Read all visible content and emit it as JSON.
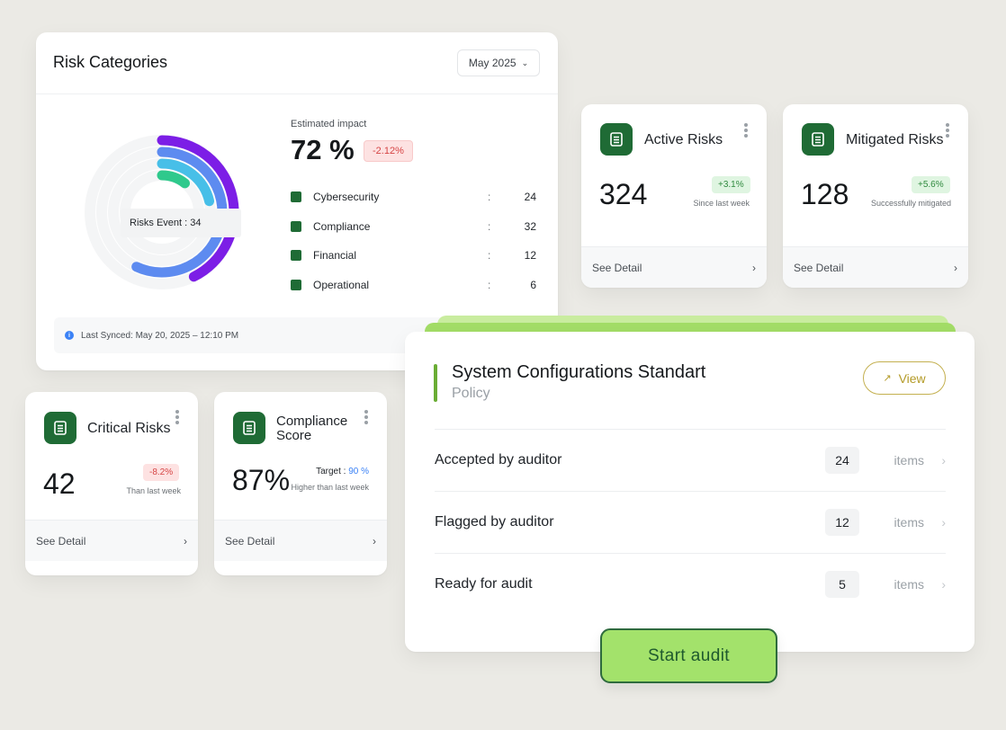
{
  "risk_categories": {
    "title": "Risk Categories",
    "month": "May 2025",
    "tooltip": "Risks Event : 34",
    "impact_label": "Estimated impact",
    "impact_value": "72 %",
    "impact_change": "-2.12%",
    "categories": [
      {
        "name": "Cybersecurity",
        "value": "24",
        "color": "#7c1ee6"
      },
      {
        "name": "Compliance",
        "value": "32",
        "color": "#5d8bf0"
      },
      {
        "name": "Financial",
        "value": "12",
        "color": "#47bfe8"
      },
      {
        "name": "Operational",
        "value": "6",
        "color": "#2fc98c"
      }
    ],
    "sync_text": "Last Synced: May 20, 2025 – 12:10 PM"
  },
  "active_risks": {
    "title": "Active Risks",
    "value": "324",
    "badge": "+3.1%",
    "subtext": "Since last week",
    "detail": "See Detail"
  },
  "mitigated_risks": {
    "title": "Mitigated Risks",
    "value": "128",
    "badge": "+5.6%",
    "subtext": "Successfully mitigated",
    "detail": "See Detail"
  },
  "critical_risks": {
    "title": "Critical Risks",
    "value": "42",
    "badge": "-8.2%",
    "subtext": "Than last week",
    "detail": "See Detail"
  },
  "compliance_score": {
    "title_line1": "Compliance",
    "title_line2": "Score",
    "value": "87%",
    "target_label": "Target :",
    "target_value": "90 %",
    "subtext": "Higher than last week",
    "detail": "See Detail"
  },
  "policy": {
    "title": "System Configurations Standart",
    "subtitle": "Policy",
    "view_label": "View",
    "rows": [
      {
        "label": "Accepted by auditor",
        "count": "24",
        "unit": "items"
      },
      {
        "label": "Flagged by auditor",
        "count": "12",
        "unit": "items"
      },
      {
        "label": "Ready for audit",
        "count": "5",
        "unit": "items"
      }
    ],
    "start_label": "Start audit"
  },
  "icons": {
    "card": "document-icon",
    "month_select": "chevron-down-icon",
    "view": "arrow-up-right-icon",
    "sync": "info-icon",
    "detail": "chevron-right-icon"
  },
  "colors": {
    "brand_green": "#1f6b35",
    "start_button": "#a3e26b",
    "badge_up": "#2f8a3e",
    "badge_down": "#d64545",
    "view_gold": "#b39a26"
  }
}
